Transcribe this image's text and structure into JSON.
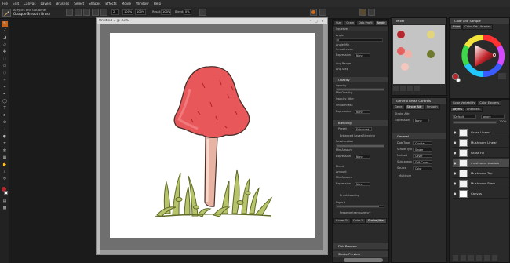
{
  "menu": [
    "File",
    "Edit",
    "Canvas",
    "Layers",
    "Brushes",
    "Select",
    "Shapes",
    "Effects",
    "Movie",
    "Window",
    "Help"
  ],
  "propbar": {
    "brush_category": "Acrylics and Gouache",
    "brush_variant": "Opaque Smooth Brush",
    "size_value": "2",
    "size_unit": "",
    "opacity_value": "100%",
    "grain_value": "100%",
    "resat_label": "Resat:",
    "resat_value": "100%",
    "bleed_label": "Bleed:",
    "bleed_value": "0%"
  },
  "document": {
    "title": "Untitled-3 @ 33%",
    "win_min": "–",
    "win_max": "▢",
    "win_close": "✕"
  },
  "brush_controls": {
    "tabs": [
      "Size",
      "Grain",
      "Dab Profil",
      "Angle"
    ],
    "section_squeeze": "Squeeze",
    "rows_angle": [
      {
        "label": "Angle Min",
        "value": "0°"
      },
      {
        "label": "Smoothness",
        "value": ""
      },
      {
        "label": "Ang Range",
        "value": "0°"
      },
      {
        "label": "Ang Step",
        "value": "0°"
      }
    ],
    "angle_label": "Angle",
    "angle_value": "0°",
    "expression_label": "Expression",
    "expression_value": "None",
    "section_opacity": "Opacity",
    "opacity_rows": [
      {
        "label": "Opacity",
        "value": "100%"
      },
      {
        "label": "Min Opacity",
        "value": "0%"
      },
      {
        "label": "Opacity Jitter",
        "value": "0%"
      },
      {
        "label": "Smoothness",
        "value": "0%"
      }
    ],
    "opacity_expression": "None",
    "section_blending": "Blending",
    "preset_label": "Preset",
    "preset_value": "Enhanced",
    "enhanced_layer": "Enhanced Layer Blending",
    "blending_rows": [
      {
        "label": "Resaturation",
        "value": "100%"
      },
      {
        "label": "Min Amount",
        "value": "0%"
      },
      {
        "label": "Expression",
        "value": "None"
      },
      {
        "label": "Bleed",
        "value": "0%"
      },
      {
        "label": "Amount",
        "value": "0%"
      },
      {
        "label": "Min Amount",
        "value": "0%"
      },
      {
        "label": "Expression",
        "value": "None"
      }
    ],
    "brush_loading": "Brush Loading",
    "dryout_label": "Dryout",
    "dryout_value": "1.0",
    "preserve": "Preserve transparency",
    "bottom_tabs": [
      "Cover Gr",
      "Color V",
      "Stroke Jitter"
    ],
    "dab_preview": "Dab Preview",
    "stroke_preview": "Stroke Preview"
  },
  "mixer": {
    "title": "Mixer",
    "swatches": [
      "#b5272e",
      "#e3d67a",
      "#e85f5f",
      "#f3b0a6",
      "#6f7a2c",
      "#f4c6bd"
    ],
    "mix_colors": [
      "#e3868b",
      "#b0252b",
      "#f2b4a5"
    ]
  },
  "general": {
    "title": "General Brush Controls",
    "tabs": [
      "Gene",
      "Stroke Attr",
      "Smooth"
    ],
    "stroke_attr": "Stroke Attr",
    "expression_label": "Expression",
    "expression_value": "None",
    "section": "General",
    "rows": [
      {
        "label": "Dab Type",
        "value": "Circular"
      },
      {
        "label": "Stroke Type",
        "value": "Single"
      },
      {
        "label": "Method",
        "value": "Cover"
      },
      {
        "label": "Subcategory",
        "value": "Soft Cover"
      },
      {
        "label": "Source",
        "value": "Color"
      }
    ],
    "realtime": "Multicore"
  },
  "color_panel": {
    "tabs": [
      "Color and Sample",
      "Color Set Libraries"
    ],
    "title": "Color and Sample",
    "sublabel": "Color",
    "sets_label": "Color Set Libraries",
    "main_color": "#b5272e",
    "bg_color": "#ffffff"
  },
  "layers_panel": {
    "tabs": [
      "Color Variability",
      "Color Express"
    ],
    "channels_tabs": [
      "Layers",
      "Channels"
    ],
    "composite": "Default",
    "ignore": "Ignore",
    "opacity": "100%",
    "layers": [
      {
        "name": "Grass Lineart",
        "selected": false
      },
      {
        "name": "Mushroom Lineart",
        "selected": false
      },
      {
        "name": "Grass Fill",
        "selected": false
      },
      {
        "name": "mushroom shadow",
        "selected": true
      },
      {
        "name": "Mushroom Top",
        "selected": false
      },
      {
        "name": "Mushroom Stem",
        "selected": false
      },
      {
        "name": "Canvas",
        "selected": false
      }
    ]
  },
  "colors": {
    "mushroom_cap": "#e8585b",
    "mushroom_cap_dark": "#b3282e",
    "stem": "#e7b4a3",
    "grass": "#b8c46b",
    "grass_dark": "#5e6a25",
    "outline": "#4a2f2b"
  }
}
